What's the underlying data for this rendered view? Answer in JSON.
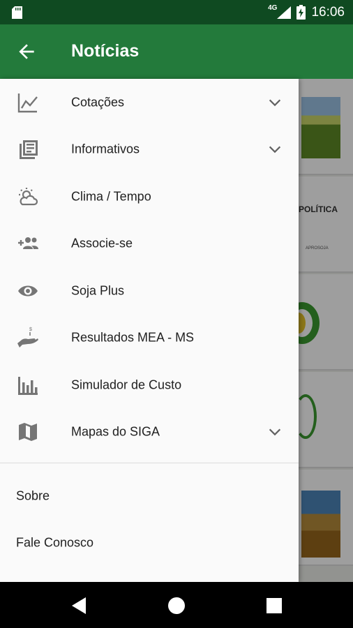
{
  "status_bar": {
    "time": "16:06",
    "network": "4G"
  },
  "app_bar": {
    "title": "Notícias"
  },
  "background": {
    "card2_text": "POLÍTICA",
    "card2_small": "APROSOJA"
  },
  "menu": {
    "items": [
      {
        "label": "Cotações",
        "icon": "chart-line-icon",
        "expandable": true
      },
      {
        "label": "Informativos",
        "icon": "newspaper-icon",
        "expandable": true
      },
      {
        "label": "Clima / Tempo",
        "icon": "weather-icon",
        "expandable": false
      },
      {
        "label": "Associe-se",
        "icon": "add-group-icon",
        "expandable": false
      },
      {
        "label": "Soja Plus",
        "icon": "eye-icon",
        "expandable": false
      },
      {
        "label": "Resultados MEA - MS",
        "icon": "hand-coin-icon",
        "expandable": false
      },
      {
        "label": "Simulador de Custo",
        "icon": "bar-chart-icon",
        "expandable": false
      },
      {
        "label": "Mapas do SIGA",
        "icon": "map-icon",
        "expandable": true
      }
    ],
    "footer": [
      {
        "label": "Sobre"
      },
      {
        "label": "Fale Conosco"
      }
    ]
  },
  "colors": {
    "status_bar": "#0f4a21",
    "app_bar": "#237a3b",
    "icon_gray": "#757575"
  }
}
